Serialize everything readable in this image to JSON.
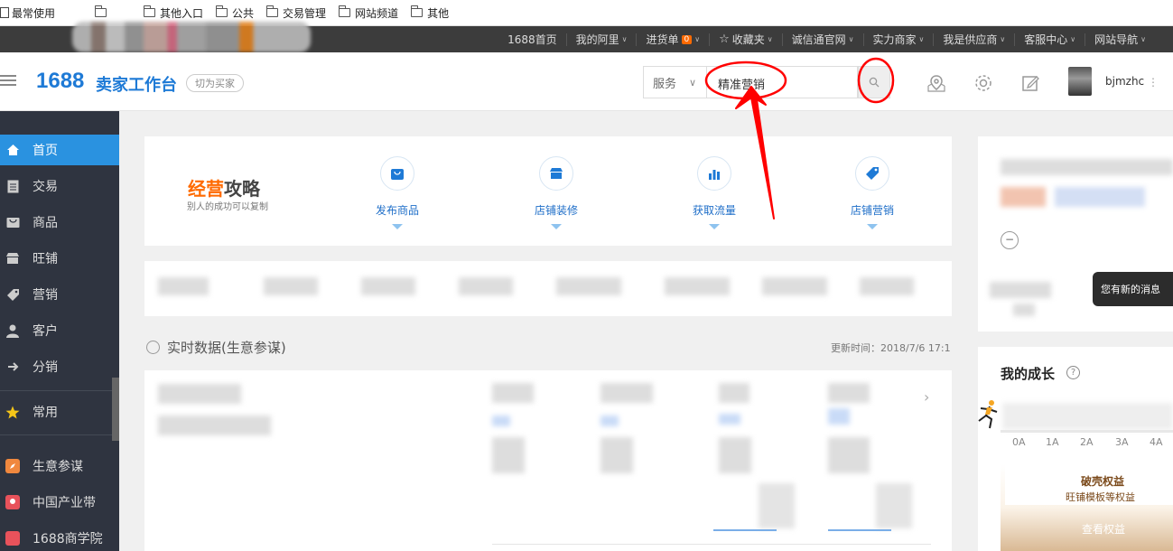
{
  "bookmarks": {
    "items": [
      "最常使用",
      "",
      "其他入口",
      "公共",
      "交易管理",
      "网站频道",
      "其他"
    ]
  },
  "topnav": {
    "items": [
      "1688首页",
      "我的阿里",
      "进货单",
      "收藏夹",
      "诚信通官网",
      "实力商家",
      "我是供应商",
      "客服中心",
      "网站导航"
    ],
    "cart_badge": "0"
  },
  "header": {
    "logo": "1688",
    "logo_sub": "卖家工作台",
    "switch_label": "切为买家",
    "search_category": "服务",
    "search_value": "精准营销",
    "username": "bjmzhc"
  },
  "sidebar": {
    "items": [
      "首页",
      "交易",
      "商品",
      "旺铺",
      "营销",
      "客户",
      "分销",
      "常用",
      "生意参谋",
      "中国产业带",
      "1688商学院"
    ]
  },
  "guide": {
    "title_hl": "经营",
    "title_rest": "攻略",
    "subtitle": "别人的成功可以复制",
    "links": [
      "发布商品",
      "店铺装修",
      "获取流量",
      "店铺营销"
    ]
  },
  "realtime": {
    "title": "实时数据(生意参谋)",
    "update_time": "更新时间：2018/7/6 17:1"
  },
  "right": {
    "new_message": "您有新的消息",
    "growth_title": "我的成长",
    "axis_labels": [
      "0A",
      "1A",
      "2A",
      "3A",
      "4A"
    ],
    "benefit_title": "破壳权益",
    "benefit_subtitle": "旺铺模板等权益",
    "benefit_button": "查看权益"
  },
  "colors": {
    "brand": "#1e7ad6",
    "sidebar_bg": "#2f3440",
    "sidebar_active": "#2a92e0",
    "topnav_bg": "#3c3c3c",
    "annotation": "#ff0000"
  }
}
